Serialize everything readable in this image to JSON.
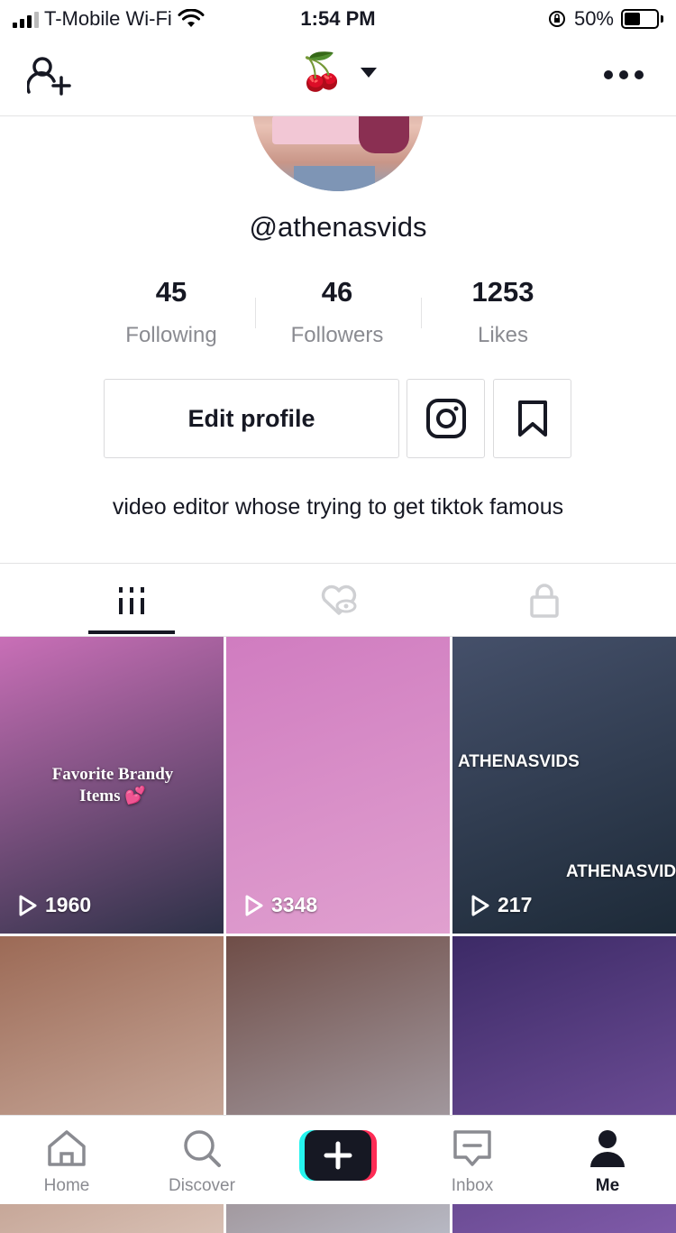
{
  "status_bar": {
    "carrier": "T-Mobile Wi-Fi",
    "time": "1:54 PM",
    "battery": "50%",
    "battery_level": 0.5
  },
  "nav": {
    "emoji": "🍒"
  },
  "profile": {
    "username": "@athenasvids",
    "stats": [
      {
        "value": "45",
        "label": "Following"
      },
      {
        "value": "46",
        "label": "Followers"
      },
      {
        "value": "1253",
        "label": "Likes"
      }
    ],
    "edit_label": "Edit profile",
    "bio": "video editor whose trying to get tiktok famous"
  },
  "videos": [
    {
      "views": "1960",
      "caption": "Favorite Brandy Items 💕",
      "colors": [
        "#c96fb7",
        "#2d3147"
      ]
    },
    {
      "views": "3348",
      "colors": [
        "#d07cc0",
        "#e0a0cf"
      ]
    },
    {
      "views": "217",
      "watermark": "ATHENASVIDS",
      "colors": [
        "#45506a",
        "#1d2a38"
      ]
    },
    {
      "colors": [
        "#9c6a56",
        "#d8c0b4"
      ]
    },
    {
      "colors": [
        "#6f4d47",
        "#b7b8c3"
      ]
    },
    {
      "colors": [
        "#3c2a66",
        "#7f5aa8"
      ]
    }
  ],
  "bottom_nav": [
    {
      "label": "Home",
      "icon": "home-icon"
    },
    {
      "label": "Discover",
      "icon": "search-icon"
    },
    {
      "label": "",
      "icon": "plus-icon"
    },
    {
      "label": "Inbox",
      "icon": "inbox-icon"
    },
    {
      "label": "Me",
      "icon": "person-icon"
    }
  ],
  "colors": {
    "text": "#161823",
    "muted": "#8a8b91",
    "tiktok_cyan": "#25f4ee",
    "tiktok_red": "#fe2c55"
  }
}
